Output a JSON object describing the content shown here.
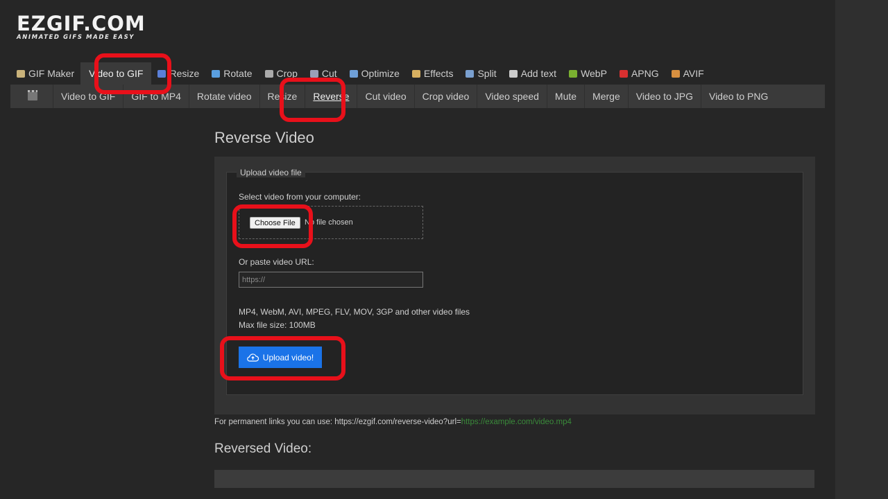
{
  "logo": {
    "main": "EZGIF.COM",
    "tagline": "ANIMATED GIFS MADE EASY"
  },
  "top_nav": [
    {
      "label": "GIF Maker",
      "icon": "gif-maker-icon",
      "color": "#c9b27a"
    },
    {
      "label": "Video to GIF",
      "icon": "video-icon",
      "color": "#888888",
      "active": true
    },
    {
      "label": "Resize",
      "icon": "resize-icon",
      "color": "#5a7fd8"
    },
    {
      "label": "Rotate",
      "icon": "rotate-icon",
      "color": "#5a9fe0"
    },
    {
      "label": "Crop",
      "icon": "crop-icon",
      "color": "#aaaaaa"
    },
    {
      "label": "Cut",
      "icon": "cut-icon",
      "color": "#9aa0b8"
    },
    {
      "label": "Optimize",
      "icon": "optimize-icon",
      "color": "#6fa0d8"
    },
    {
      "label": "Effects",
      "icon": "effects-icon",
      "color": "#d8b060"
    },
    {
      "label": "Split",
      "icon": "split-icon",
      "color": "#7aa0d0"
    },
    {
      "label": "Add text",
      "icon": "add-text-icon",
      "color": "#cccccc"
    },
    {
      "label": "WebP",
      "icon": "webp-icon",
      "color": "#7ab030"
    },
    {
      "label": "APNG",
      "icon": "apng-icon",
      "color": "#d83030"
    },
    {
      "label": "AVIF",
      "icon": "avif-icon",
      "color": "#d89040"
    }
  ],
  "sub_nav": [
    {
      "label": "Video to GIF"
    },
    {
      "label": "GIF to MP4"
    },
    {
      "label": "Rotate video"
    },
    {
      "label": "Resize"
    },
    {
      "label": "Reverse",
      "active": true
    },
    {
      "label": "Cut video"
    },
    {
      "label": "Crop video"
    },
    {
      "label": "Video speed"
    },
    {
      "label": "Mute"
    },
    {
      "label": "Merge"
    },
    {
      "label": "Video to JPG"
    },
    {
      "label": "Video to PNG"
    }
  ],
  "main": {
    "title": "Reverse Video",
    "fieldset_legend": "Upload video file",
    "select_label": "Select video from your computer:",
    "choose_file": "Choose File",
    "no_file": "No file chosen",
    "url_label": "Or paste video URL:",
    "url_placeholder": "https://",
    "formats": "MP4, WebM, AVI, MPEG, FLV, MOV, 3GP and other video files",
    "max_size": "Max file size: 100MB",
    "upload_button": "Upload video!"
  },
  "permanent": {
    "text": "For permanent links you can use: https://ezgif.com/reverse-video?url=",
    "link": "https://example.com/video.mp4"
  },
  "result": {
    "title": "Reversed Video:"
  },
  "highlight_color": "#e8101a"
}
